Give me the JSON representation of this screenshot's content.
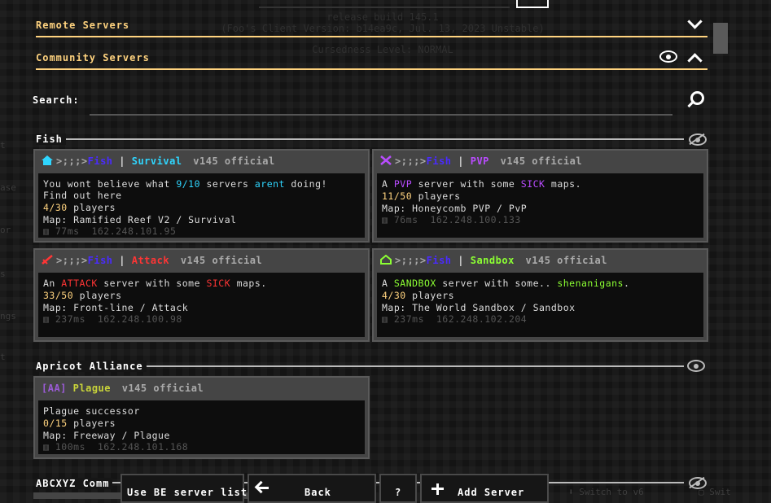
{
  "background": {
    "release_build": "release build 145.1",
    "client_version": "(Foo's Client Version: b14ea9c, Jul. 13, 2023 Unstable)",
    "cursedness": "Cursedness Level: NORMAL",
    "left_fragments": [
      "t",
      "ase",
      "or",
      "s",
      "ngs",
      "t"
    ]
  },
  "top_sections": [
    {
      "title": "Remote Servers",
      "expanded": false
    },
    {
      "title": "Community Servers",
      "expanded": true
    }
  ],
  "search": {
    "label": "Search:",
    "value": "",
    "placeholder": ""
  },
  "groups": [
    {
      "name": "Fish",
      "hidden_icon": "eye-slash-icon",
      "servers": [
        {
          "icon": "home-icon",
          "name_prefix": ">;;;>",
          "name": "Fish",
          "separator": "|",
          "mode": "Survival",
          "version": "v145 official",
          "desc_parts": [
            {
              "text": "You wont believe what ",
              "color": "#dddddd"
            },
            {
              "text": "9/10",
              "color": "#2fd6ff"
            },
            {
              "text": " servers ",
              "color": "#dddddd"
            },
            {
              "text": "arent",
              "color": "#2fd6ff"
            },
            {
              "text": " doing!",
              "color": "#dddddd"
            }
          ],
          "desc2": "Find out here",
          "players_count": "4/30",
          "players_label": "players",
          "map": "Map: Ramified Reef V2 / Survival",
          "ping": "77ms",
          "ip": "162.248.101.95"
        },
        {
          "icon": "pvp-swords-icon",
          "name_prefix": ">;;;>",
          "name": "Fish",
          "separator": "|",
          "mode": "PVP",
          "version": "v145 official",
          "desc_parts": [
            {
              "text": "A ",
              "color": "#dddddd"
            },
            {
              "text": "PVP",
              "color": "#b94cff"
            },
            {
              "text": " server with some ",
              "color": "#dddddd"
            },
            {
              "text": "SICK",
              "color": "#b94cff"
            },
            {
              "text": " maps.",
              "color": "#dddddd"
            }
          ],
          "desc2": "",
          "players_count": "11/50",
          "players_label": "players",
          "map": "Map: Honeycomb PVP / PvP",
          "ping": "76ms",
          "ip": "162.248.100.133"
        },
        {
          "icon": "attack-sword-icon",
          "name_prefix": ">;;;>",
          "name": "Fish",
          "separator": "|",
          "mode": "Attack",
          "version": "v145 official",
          "desc_parts": [
            {
              "text": "An ",
              "color": "#dddddd"
            },
            {
              "text": "ATTACK",
              "color": "#ff3535"
            },
            {
              "text": " server with some ",
              "color": "#dddddd"
            },
            {
              "text": "SICK",
              "color": "#ff3535"
            },
            {
              "text": " maps.",
              "color": "#dddddd"
            }
          ],
          "desc2": "",
          "players_count": "33/50",
          "players_label": "players",
          "map": "Map: Front-line / Attack",
          "ping": "237ms",
          "ip": "162.248.100.98"
        },
        {
          "icon": "sandbox-house-icon",
          "name_prefix": ">;;;>",
          "name": "Fish",
          "separator": "|",
          "mode": "Sandbox",
          "version": "v145 official",
          "desc_parts": [
            {
              "text": "A ",
              "color": "#dddddd"
            },
            {
              "text": "SANDBOX",
              "color": "#8cff33"
            },
            {
              "text": " server with some.. ",
              "color": "#dddddd"
            },
            {
              "text": "shenanigans",
              "color": "#8cff33"
            },
            {
              "text": ".",
              "color": "#dddddd"
            }
          ],
          "desc2": "",
          "players_count": "4/30",
          "players_label": "players",
          "map": "Map: The World Sandbox / Sandbox",
          "ping": "237ms",
          "ip": "162.248.102.204"
        }
      ]
    },
    {
      "name": "Apricot Alliance",
      "hidden_icon": "eye-icon",
      "servers": [
        {
          "tag": "[AA]",
          "name": "Plague",
          "version": "v145 official",
          "desc": "Plague successor",
          "players_count": "0/15",
          "players_label": "players",
          "map": "Map: Freeway / Plague",
          "ping": "100ms",
          "ip": "162.248.101.168"
        }
      ]
    },
    {
      "name": "ABCXYZ Comm",
      "hidden_icon": "eye-slash-icon",
      "servers": []
    }
  ],
  "bottom_buttons": {
    "use_be": "Use BE server list",
    "back": "Back",
    "help": "?",
    "add_server": "Add Server",
    "faded_switch": "Switch to v6",
    "faded_right": "Swit"
  },
  "colors": {
    "accent": "#ffd37f",
    "fish": "#4a2bff",
    "survival": "#2fd6ff",
    "pvp": "#b94cff",
    "attack": "#ff3535",
    "sandbox": "#8cff33",
    "card_bg": "#454545",
    "card_body": "#0d0d0d"
  }
}
